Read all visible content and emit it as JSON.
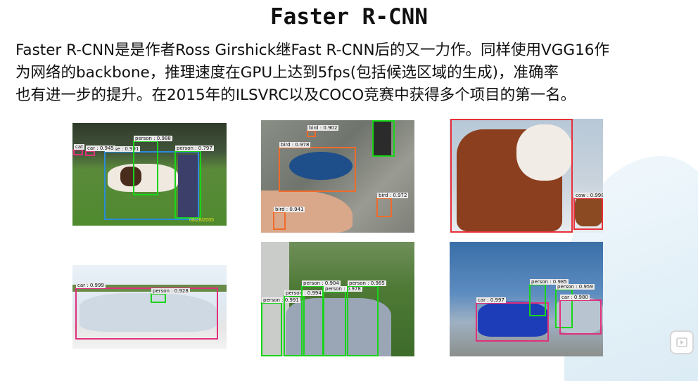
{
  "title": "Faster R-CNN",
  "paragraph": {
    "line1": "Faster R-CNN是是作者Ross Girshick继Fast R-CNN后的又一力作。同样使用VGG16作",
    "line2": "为网络的backbone，推理速度在GPU上达到5fps(包括候选区域的生成)，准确率",
    "line3": "也有进一步的提升。在2015年的ILSVRC以及COCO竞赛中获得多个项目的第一名。"
  },
  "images": {
    "horse": {
      "timestamp": "08/28/2005",
      "labels": [
        "person : 0.988",
        "person : 0.797",
        "car : 0.945",
        "horse : 0.991",
        "cat"
      ]
    },
    "birds": {
      "labels": [
        "bird : 0.902",
        "bird : 0.978",
        "bird : 0.972",
        "bird : 0.941"
      ]
    },
    "cows": {
      "labels": [
        "cow : 0.998"
      ]
    },
    "car": {
      "labels": [
        "car : 0.999",
        "person : 0.928"
      ]
    },
    "people": {
      "labels": [
        "person : 0.904",
        "person : 0.991",
        "person : 0.994",
        "person : 0.978",
        "person : 0.985"
      ]
    },
    "cars": {
      "labels": [
        "car : 0.997",
        "person : 0.985",
        "person : 0.959",
        "car : 0.980"
      ]
    }
  },
  "colors": {
    "green": "#19d419",
    "blue": "#2a8bd8",
    "pink": "#e0317a",
    "orange": "#ef6b2b",
    "red": "#e8303a"
  },
  "icons": {
    "corner": "play-icon"
  }
}
